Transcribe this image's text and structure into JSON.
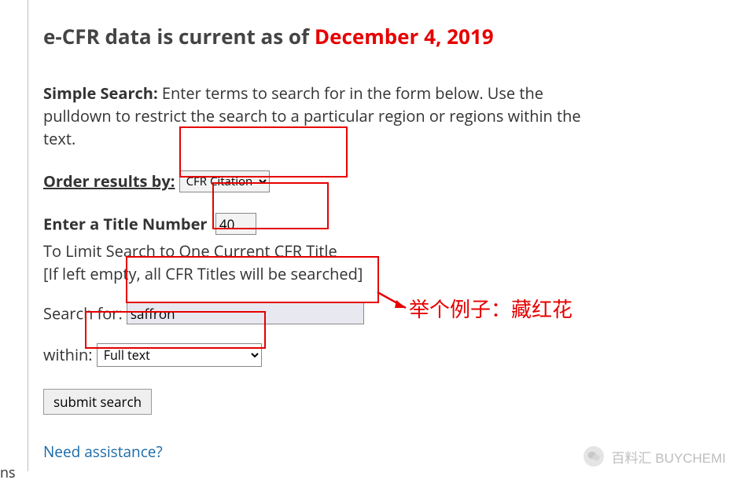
{
  "edge": {
    "cut_text": "ns"
  },
  "header": {
    "prefix": "e-CFR data is current as of ",
    "date": "December 4, 2019"
  },
  "intro": {
    "label": "Simple Search:",
    "text": " Enter terms to search for in the form below. Use the pulldown to restrict the search to a particular region or regions within the text."
  },
  "order": {
    "label": "Order results by:",
    "selected": "CFR Citation"
  },
  "title_num": {
    "label": "Enter a Title Number",
    "value": "40",
    "sub1": "To Limit Search to One Current CFR Title",
    "sub2": "[If left empty, all CFR Titles will be searched]"
  },
  "search_for": {
    "label": "Search for:",
    "value": "saffron"
  },
  "within": {
    "label": "within:",
    "selected": "Full text"
  },
  "submit": {
    "label": "submit search"
  },
  "assist": {
    "label": "Need assistance?"
  },
  "annotation": {
    "example_text": "举个例子：藏红花"
  },
  "watermark": {
    "text": "百料汇 BUYCHEMI"
  }
}
